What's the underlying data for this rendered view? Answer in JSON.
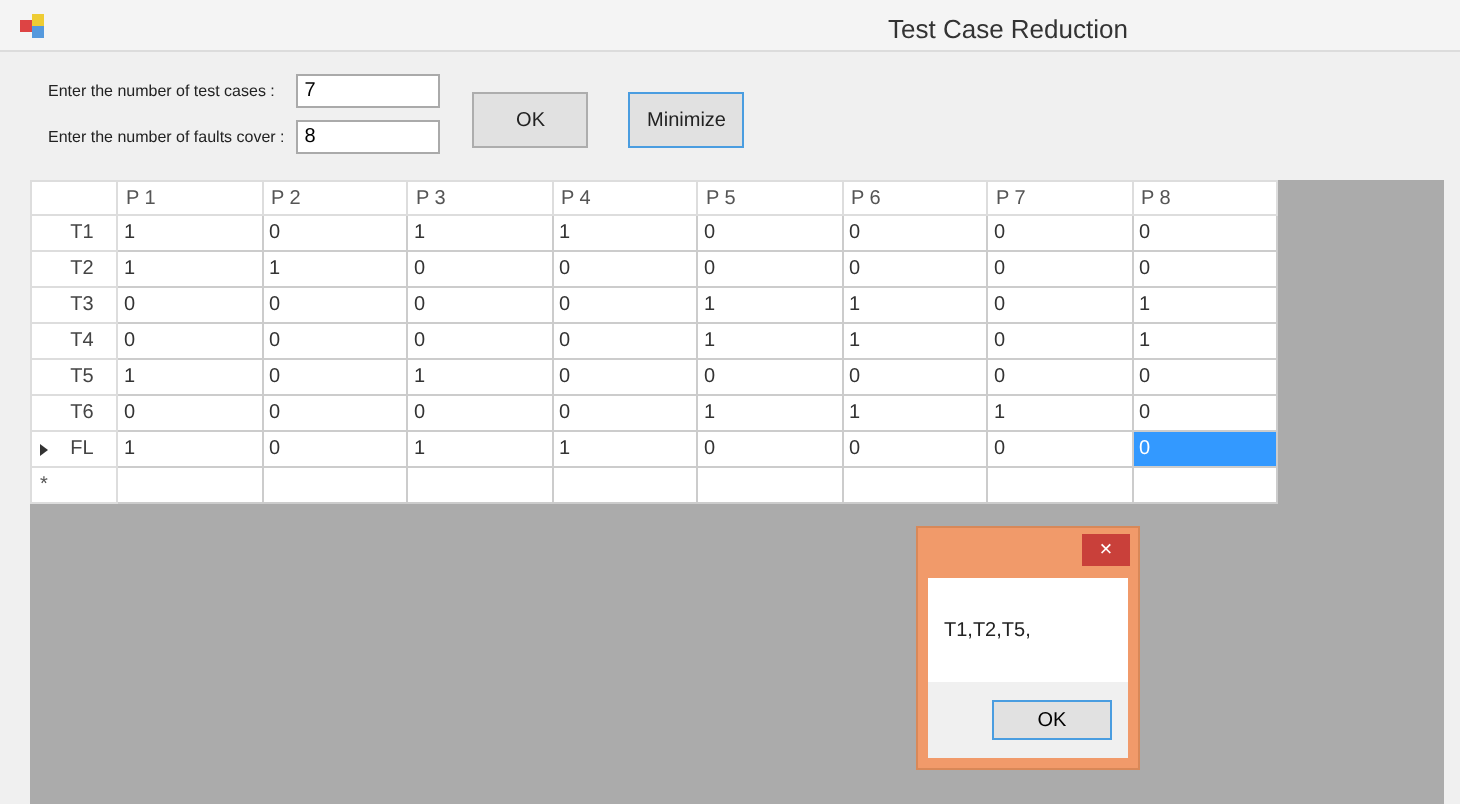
{
  "window": {
    "title": "Test Case Reduction"
  },
  "form": {
    "fields": [
      {
        "label": "Enter the number of test cases :",
        "value": "7"
      },
      {
        "label": "Enter the number of faults cover :",
        "value": "8"
      }
    ],
    "buttons": [
      {
        "label": "OK",
        "focused": false
      },
      {
        "label": "Minimize",
        "focused": true
      }
    ]
  },
  "grid": {
    "columns": [
      "P 1",
      "P 2",
      "P 3",
      "P 4",
      "P 5",
      "P 6",
      "P 7",
      "P 8"
    ],
    "rows": [
      {
        "label": "T1",
        "current": false,
        "cells": [
          {
            "value": "1",
            "selected": false
          },
          {
            "value": "0",
            "selected": false
          },
          {
            "value": "1",
            "selected": false
          },
          {
            "value": "1",
            "selected": false
          },
          {
            "value": "0",
            "selected": false
          },
          {
            "value": "0",
            "selected": false
          },
          {
            "value": "0",
            "selected": false
          },
          {
            "value": "0",
            "selected": false
          }
        ]
      },
      {
        "label": "T2",
        "current": false,
        "cells": [
          {
            "value": "1",
            "selected": false
          },
          {
            "value": "1",
            "selected": false
          },
          {
            "value": "0",
            "selected": false
          },
          {
            "value": "0",
            "selected": false
          },
          {
            "value": "0",
            "selected": false
          },
          {
            "value": "0",
            "selected": false
          },
          {
            "value": "0",
            "selected": false
          },
          {
            "value": "0",
            "selected": false
          }
        ]
      },
      {
        "label": "T3",
        "current": false,
        "cells": [
          {
            "value": "0",
            "selected": false
          },
          {
            "value": "0",
            "selected": false
          },
          {
            "value": "0",
            "selected": false
          },
          {
            "value": "0",
            "selected": false
          },
          {
            "value": "1",
            "selected": false
          },
          {
            "value": "1",
            "selected": false
          },
          {
            "value": "0",
            "selected": false
          },
          {
            "value": "1",
            "selected": false
          }
        ]
      },
      {
        "label": "T4",
        "current": false,
        "cells": [
          {
            "value": "0",
            "selected": false
          },
          {
            "value": "0",
            "selected": false
          },
          {
            "value": "0",
            "selected": false
          },
          {
            "value": "0",
            "selected": false
          },
          {
            "value": "1",
            "selected": false
          },
          {
            "value": "1",
            "selected": false
          },
          {
            "value": "0",
            "selected": false
          },
          {
            "value": "1",
            "selected": false
          }
        ]
      },
      {
        "label": "T5",
        "current": false,
        "cells": [
          {
            "value": "1",
            "selected": false
          },
          {
            "value": "0",
            "selected": false
          },
          {
            "value": "1",
            "selected": false
          },
          {
            "value": "0",
            "selected": false
          },
          {
            "value": "0",
            "selected": false
          },
          {
            "value": "0",
            "selected": false
          },
          {
            "value": "0",
            "selected": false
          },
          {
            "value": "0",
            "selected": false
          }
        ]
      },
      {
        "label": "T6",
        "current": false,
        "cells": [
          {
            "value": "0",
            "selected": false
          },
          {
            "value": "0",
            "selected": false
          },
          {
            "value": "0",
            "selected": false
          },
          {
            "value": "0",
            "selected": false
          },
          {
            "value": "1",
            "selected": false
          },
          {
            "value": "1",
            "selected": false
          },
          {
            "value": "1",
            "selected": false
          },
          {
            "value": "0",
            "selected": false
          }
        ]
      },
      {
        "label": "FL",
        "current": true,
        "cells": [
          {
            "value": "1",
            "selected": false
          },
          {
            "value": "0",
            "selected": false
          },
          {
            "value": "1",
            "selected": false
          },
          {
            "value": "1",
            "selected": false
          },
          {
            "value": "0",
            "selected": false
          },
          {
            "value": "0",
            "selected": false
          },
          {
            "value": "0",
            "selected": false
          },
          {
            "value": "0",
            "selected": true
          }
        ]
      }
    ],
    "new_row_marker": "*"
  },
  "dialog": {
    "close": "×",
    "message": "T1,T2,T5,",
    "button": "OK"
  }
}
